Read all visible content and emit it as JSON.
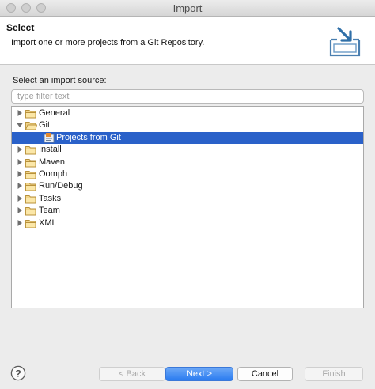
{
  "window": {
    "title": "Import"
  },
  "banner": {
    "title": "Select",
    "description": "Import one or more projects from a Git Repository."
  },
  "source": {
    "label": "Select an import source:",
    "filter_placeholder": "type filter text",
    "filter_value": ""
  },
  "tree": {
    "items": [
      {
        "label": "General",
        "level": 0,
        "expanded": false,
        "type": "folder"
      },
      {
        "label": "Git",
        "level": 0,
        "expanded": true,
        "type": "folder"
      },
      {
        "label": "Projects from Git",
        "level": 1,
        "selected": true,
        "type": "git-project"
      },
      {
        "label": "Install",
        "level": 0,
        "expanded": false,
        "type": "folder"
      },
      {
        "label": "Maven",
        "level": 0,
        "expanded": false,
        "type": "folder"
      },
      {
        "label": "Oomph",
        "level": 0,
        "expanded": false,
        "type": "folder"
      },
      {
        "label": "Run/Debug",
        "level": 0,
        "expanded": false,
        "type": "folder"
      },
      {
        "label": "Tasks",
        "level": 0,
        "expanded": false,
        "type": "folder"
      },
      {
        "label": "Team",
        "level": 0,
        "expanded": false,
        "type": "folder"
      },
      {
        "label": "XML",
        "level": 0,
        "expanded": false,
        "type": "folder"
      }
    ]
  },
  "buttons": {
    "back": "< Back",
    "next": "Next >",
    "cancel": "Cancel",
    "finish": "Finish"
  },
  "icons": {
    "help": "help-icon",
    "banner": "import-icon",
    "folder": "folder-icon",
    "git_project": "git-project-icon"
  },
  "colors": {
    "selection": "#2a61c9",
    "primary_button": "#2a7bf0",
    "folder": "#e8c36a"
  }
}
